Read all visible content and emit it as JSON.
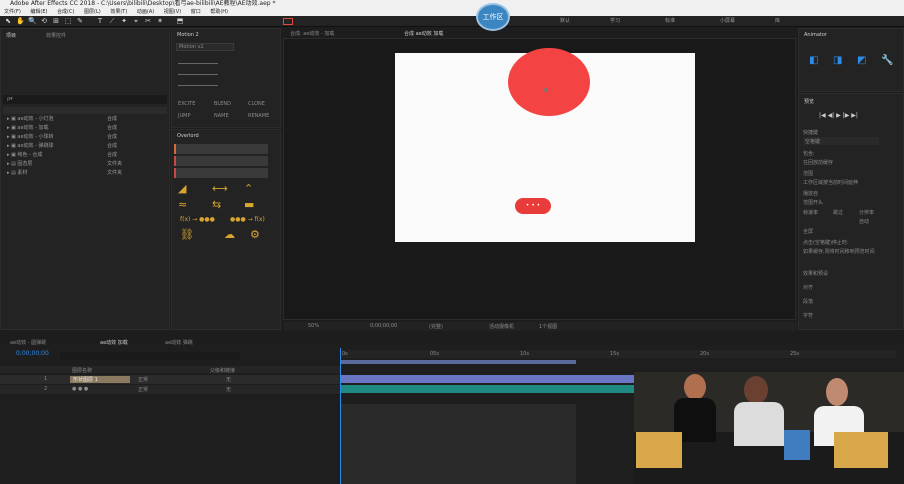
{
  "window": {
    "title": "Adobe After Effects CC 2018 - C:\\Users\\bilibili\\Desktop\\看弓ae-bilibili\\AE教程\\AE动效.aep *",
    "menu": [
      "文件(F)",
      "编辑(E)",
      "合成(C)",
      "图层(L)",
      "效果(T)",
      "动画(A)",
      "视图(V)",
      "窗口",
      "帮助(H)"
    ]
  },
  "toolbar": {
    "tools": [
      "⬉",
      "✋",
      "🔍",
      "⟲",
      "⊞",
      "⬚",
      "✎",
      "T",
      "⟋",
      "✦",
      "⌖",
      "✂",
      "✶",
      "⬒"
    ],
    "workspaces": [
      "默认",
      "学习",
      "标准",
      "小屏幕",
      "库"
    ],
    "badge": "工作区"
  },
  "project": {
    "tab": "项目",
    "secondary_tab": "效果控件",
    "search_placeholder": "ρ▾",
    "items": [
      {
        "name": "ae动效 - 小灯泡",
        "label": "合成"
      },
      {
        "name": "ae动效 - 加载",
        "label": "合成"
      },
      {
        "name": "ae动效 - 小球转",
        "label": "合成"
      },
      {
        "name": "ae动效 - 弹跳球",
        "label": "合成"
      },
      {
        "name": "纯色 - 合成",
        "label": "合成"
      },
      {
        "name": "固态层",
        "label": "文件夹"
      },
      {
        "name": "素材",
        "label": "文件夹"
      }
    ]
  },
  "properties": {
    "tab": "Motion 2",
    "dropdown": "Motion v2",
    "labels": [
      "EXCITE",
      "BLEND",
      "CLONE",
      "JUMP",
      "NAME",
      "RENAME"
    ]
  },
  "bounce_panel": {
    "tab": "Overlord",
    "presets": [
      "f(x) → ●●●",
      "●●● → f(x)"
    ]
  },
  "composition": {
    "tab_left": "合成: ae动效 - 加载",
    "tab_active": "合成 ae动效 加载",
    "zoom": "50%",
    "time": "0;00;00;00",
    "quality": "(完整)",
    "camera": "活动摄像机",
    "views": "1个视图",
    "pill_text": "• • •"
  },
  "right_panels": {
    "top_tab": "Animator",
    "preview_tab": "预览",
    "preview_controls": [
      "|◀",
      "◀|",
      "▶",
      "|▶",
      "▶|"
    ],
    "shortcut_label": "快捷键",
    "shortcut_value": "空格键",
    "options": [
      "包含:",
      "在回放前缓存",
      "范围",
      "工作区域按当前时间延伸",
      "播放自",
      "范围开头",
      "帧速率",
      "跳过",
      "分辨率",
      "自动",
      "全屏",
      "点击(空格键)停止时:",
      "如果缓存,则将时间移到预览时间"
    ],
    "sections": [
      "效果和预设",
      "对齐",
      "段落",
      "字符",
      "跟踪器"
    ]
  },
  "timeline": {
    "tabs": [
      "ae动效 - 圆弹跳",
      "ae动效 加载",
      "ae动效 弹跳"
    ],
    "current_time": "0;00;00;00",
    "columns": [
      "图层名称",
      "父级和链接"
    ],
    "layers": [
      {
        "num": "1",
        "name": "形状图层 1",
        "mode": "正常",
        "parent": "无"
      },
      {
        "num": "2",
        "name": "● ● ●",
        "mode": "正常",
        "parent": "无"
      }
    ],
    "ruler_labels": [
      "0s",
      "05s",
      "10s",
      "15s",
      "20s",
      "25s",
      "30s"
    ]
  },
  "colors": {
    "accent_blue": "#2d8ceb",
    "ae_red": "#f44343",
    "panel_bg": "#232323",
    "layer_bar": "#6a75c4",
    "teal_bar": "#1f8a82"
  }
}
